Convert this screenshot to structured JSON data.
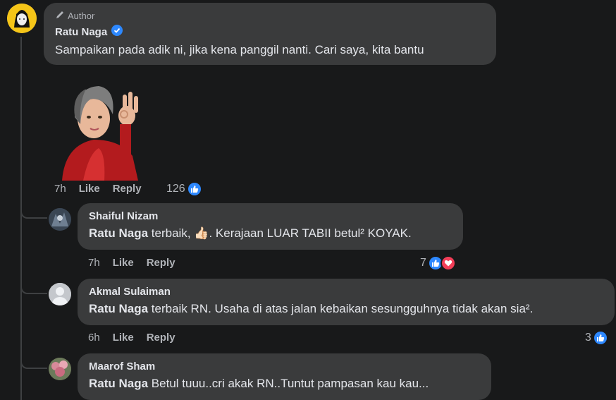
{
  "main_comment": {
    "author_badge": "Author",
    "name": "Ratu Naga",
    "text": "Sampaikan pada adik ni, jika kena panggil nanti. Cari saya, kita bantu",
    "time": "7h",
    "like_label": "Like",
    "reply_label": "Reply",
    "reaction_count": "126"
  },
  "replies": [
    {
      "name": "Shaiful Nizam",
      "mention": "Ratu Naga",
      "text_before_emoji": " terbaik, ",
      "emoji": "👍🏻",
      "text_after_emoji": ". Kerajaan LUAR TABII betul² KOYAK.",
      "time": "7h",
      "like_label": "Like",
      "reply_label": "Reply",
      "reaction_count": "7"
    },
    {
      "name": "Akmal Sulaiman",
      "mention": "Ratu Naga",
      "text": " terbaik RN. Usaha di atas jalan kebaikan sesungguhnya tidak akan sia².",
      "time": "6h",
      "like_label": "Like",
      "reply_label": "Reply",
      "reaction_count": "3"
    },
    {
      "name": "Maarof Sham",
      "mention": "Ratu Naga",
      "text": " Betul tuuu..cri akak RN..Tuntut pampasan kau kau..."
    }
  ],
  "colors": {
    "background": "#18191a",
    "bubble": "#3a3b3c",
    "like_blue": "#2d88ff",
    "love_red": "#f33e58",
    "verified_blue": "#2d88ff"
  }
}
